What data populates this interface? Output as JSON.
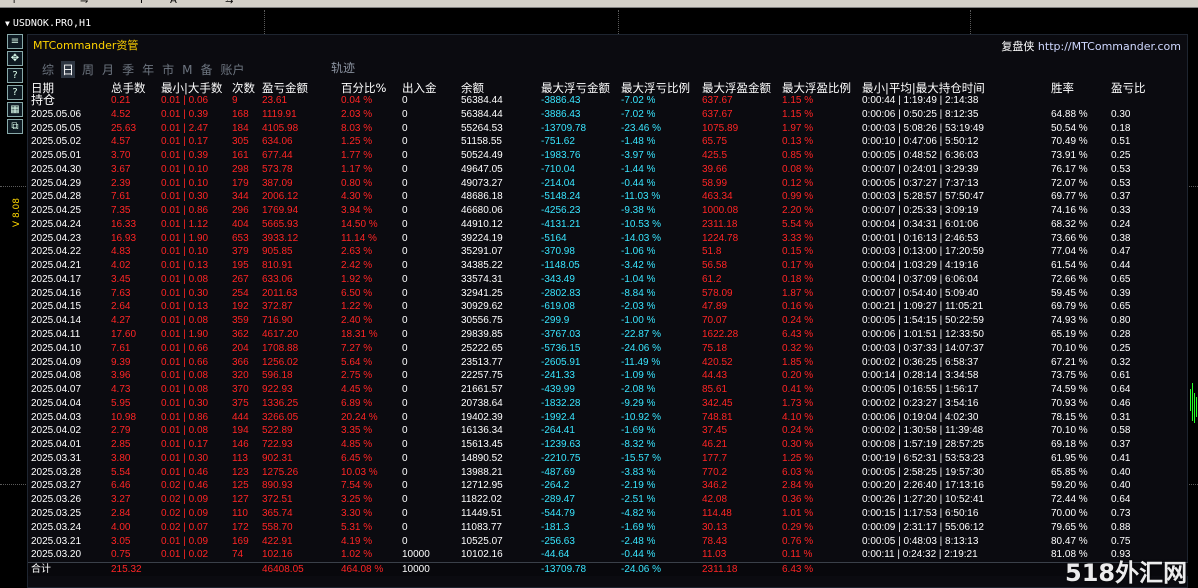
{
  "window": {
    "symbol_title": "USDNOK.PRO,H1",
    "tri": "▼"
  },
  "toolbar": {
    "items": [
      "↑",
      "⇋",
      "F",
      "A",
      "⇆"
    ]
  },
  "side": {
    "label": "V 8.08",
    "icons": [
      "≡",
      "✥",
      "?",
      "?",
      "▦",
      "⧉"
    ]
  },
  "panel": {
    "brand": "MTCommander资管",
    "cred_prefix": "复盘侠",
    "cred_url": "http://MTCommander.com",
    "tabs": [
      "综",
      "日",
      "周",
      "月",
      "季",
      "年",
      "市",
      "M",
      "备",
      "账户"
    ],
    "active_tab": "日",
    "track_label": "轨迹"
  },
  "columns": [
    "日期",
    "总手数",
    "最小|大手数",
    "次数",
    "盈亏金额",
    "百分比%",
    "出入金",
    "余额",
    "最大浮亏金额",
    "最大浮亏比例",
    "最大浮盈金额",
    "最大浮盈比例",
    "最小|平均|最大持仓时间",
    "胜率",
    "盈亏比"
  ],
  "holding": [
    "持仓",
    "0.21",
    "0.01 | 0.06",
    "9",
    "23.61",
    "0.04 %",
    "0",
    "56384.44",
    "-3886.43",
    "-7.02 %",
    "637.67",
    "1.15 %",
    "0:00:44 | 1:19:49 | 2:14:38",
    "",
    ""
  ],
  "rows": [
    [
      "2025.05.06",
      "4.52",
      "0.01 | 0.39",
      "168",
      "1119.91",
      "2.03 %",
      "0",
      "56384.44",
      "-3886.43",
      "-7.02 %",
      "637.67",
      "1.15 %",
      "0:00:06 | 0:50:25 | 8:12:35",
      "64.88 %",
      "0.30"
    ],
    [
      "2025.05.05",
      "25.63",
      "0.01 | 2.47",
      "184",
      "4105.98",
      "8.03 %",
      "0",
      "55264.53",
      "-13709.78",
      "-23.46 %",
      "1075.89",
      "1.97 %",
      "0:00:03 | 5:08:26 | 53:19:49",
      "50.54 %",
      "0.18"
    ],
    [
      "2025.05.02",
      "4.57",
      "0.01 | 0.17",
      "305",
      "634.06",
      "1.25 %",
      "0",
      "51158.55",
      "-751.62",
      "-1.48 %",
      "65.75",
      "0.13 %",
      "0:00:10 | 0:47:06 | 5:50:12",
      "70.49 %",
      "0.51"
    ],
    [
      "2025.05.01",
      "3.70",
      "0.01 | 0.39",
      "161",
      "677.44",
      "1.77 %",
      "0",
      "50524.49",
      "-1983.76",
      "-3.97 %",
      "425.5",
      "0.85 %",
      "0:00:05 | 0:48:52 | 6:36:03",
      "73.91 %",
      "0.25"
    ],
    [
      "2025.04.30",
      "3.67",
      "0.01 | 0.10",
      "298",
      "573.78",
      "1.17 %",
      "0",
      "49647.05",
      "-710.04",
      "-1.44 %",
      "39.66",
      "0.08 %",
      "0:00:07 | 0:24:01 | 3:29:39",
      "76.17 %",
      "0.53"
    ],
    [
      "2025.04.29",
      "2.39",
      "0.01 | 0.10",
      "179",
      "387.09",
      "0.80 %",
      "0",
      "49073.27",
      "-214.04",
      "-0.44 %",
      "58.99",
      "0.12 %",
      "0:00:05 | 0:37:27 | 7:37:13",
      "72.07 %",
      "0.53"
    ],
    [
      "2025.04.28",
      "7.61",
      "0.01 | 0.30",
      "344",
      "2006.12",
      "4.30 %",
      "0",
      "48686.18",
      "-5148.24",
      "-11.03 %",
      "463.34",
      "0.99 %",
      "0:00:03 | 5:28:57 | 57:50:47",
      "69.77 %",
      "0.37"
    ],
    [
      "2025.04.25",
      "7.35",
      "0.01 | 0.86",
      "296",
      "1769.94",
      "3.94 %",
      "0",
      "46680.06",
      "-4256.23",
      "-9.38 %",
      "1000.08",
      "2.20 %",
      "0:00:07 | 0:25:33 | 3:09:19",
      "74.16 %",
      "0.33"
    ],
    [
      "2025.04.24",
      "16.33",
      "0.01 | 1.12",
      "404",
      "5665.93",
      "14.50 %",
      "0",
      "44910.12",
      "-4131.21",
      "-10.53 %",
      "2311.18",
      "5.54 %",
      "0:00:04 | 0:34:31 | 6:01:06",
      "68.32 %",
      "0.24"
    ],
    [
      "2025.04.23",
      "16.93",
      "0.01 | 1.90",
      "653",
      "3933.12",
      "11.14 %",
      "0",
      "39224.19",
      "-5164",
      "-14.03 %",
      "1224.78",
      "3.33 %",
      "0:00:01 | 0:16:13 | 2:46:53",
      "73.66 %",
      "0.38"
    ],
    [
      "2025.04.22",
      "4.83",
      "0.01 | 0.10",
      "379",
      "905.85",
      "2.63 %",
      "0",
      "35291.07",
      "-370.98",
      "-1.06 %",
      "51.8",
      "0.15 %",
      "0:00:03 | 0:13:00 | 17:20:59",
      "77.04 %",
      "0.47"
    ],
    [
      "2025.04.21",
      "4.02",
      "0.01 | 0.13",
      "195",
      "810.91",
      "2.42 %",
      "0",
      "34385.22",
      "-1148.05",
      "-3.42 %",
      "56.58",
      "0.17 %",
      "0:00:04 | 1:03:29 | 4:19:16",
      "61.54 %",
      "0.44"
    ],
    [
      "2025.04.17",
      "3.45",
      "0.01 | 0.08",
      "267",
      "633.06",
      "1.92 %",
      "0",
      "33574.31",
      "-343.49",
      "-1.04 %",
      "61.2",
      "0.18 %",
      "0:00:04 | 0:37:09 | 6:06:04",
      "72.66 %",
      "0.65"
    ],
    [
      "2025.04.16",
      "7.63",
      "0.01 | 0.30",
      "254",
      "2011.63",
      "6.50 %",
      "0",
      "32941.25",
      "-2802.83",
      "-8.84 %",
      "578.09",
      "1.87 %",
      "0:00:07 | 0:54:40 | 5:09:40",
      "59.45 %",
      "0.39"
    ],
    [
      "2025.04.15",
      "2.64",
      "0.01 | 0.13",
      "192",
      "372.87",
      "1.22 %",
      "0",
      "30929.62",
      "-619.08",
      "-2.03 %",
      "47.89",
      "0.16 %",
      "0:00:21 | 1:09:27 | 11:05:21",
      "69.79 %",
      "0.65"
    ],
    [
      "2025.04.14",
      "4.27",
      "0.01 | 0.08",
      "359",
      "716.90",
      "2.40 %",
      "0",
      "30556.75",
      "-299.9",
      "-1.00 %",
      "70.07",
      "0.24 %",
      "0:00:05 | 1:54:15 | 50:22:59",
      "74.93 %",
      "0.80"
    ],
    [
      "2025.04.11",
      "17.60",
      "0.01 | 1.90",
      "362",
      "4617.20",
      "18.31 %",
      "0",
      "29839.85",
      "-3767.03",
      "-22.87 %",
      "1622.28",
      "6.43 %",
      "0:00:06 | 1:01:51 | 12:33:50",
      "65.19 %",
      "0.28"
    ],
    [
      "2025.04.10",
      "7.61",
      "0.01 | 0.66",
      "204",
      "1708.88",
      "7.27 %",
      "0",
      "25222.65",
      "-5736.15",
      "-24.06 %",
      "75.18",
      "0.32 %",
      "0:00:03 | 0:37:33 | 14:07:37",
      "70.10 %",
      "0.25"
    ],
    [
      "2025.04.09",
      "9.39",
      "0.01 | 0.66",
      "366",
      "1256.02",
      "5.64 %",
      "0",
      "23513.77",
      "-2605.91",
      "-11.49 %",
      "420.52",
      "1.85 %",
      "0:00:02 | 0:36:25 | 6:58:37",
      "67.21 %",
      "0.32"
    ],
    [
      "2025.04.08",
      "3.96",
      "0.01 | 0.08",
      "320",
      "596.18",
      "2.75 %",
      "0",
      "22257.75",
      "-241.33",
      "-1.09 %",
      "44.43",
      "0.20 %",
      "0:00:14 | 0:28:14 | 3:34:58",
      "73.75 %",
      "0.61"
    ],
    [
      "2025.04.07",
      "4.73",
      "0.01 | 0.08",
      "370",
      "922.93",
      "4.45 %",
      "0",
      "21661.57",
      "-439.99",
      "-2.08 %",
      "85.61",
      "0.41 %",
      "0:00:05 | 0:16:55 | 1:56:17",
      "74.59 %",
      "0.64"
    ],
    [
      "2025.04.04",
      "5.95",
      "0.01 | 0.30",
      "375",
      "1336.25",
      "6.89 %",
      "0",
      "20738.64",
      "-1832.28",
      "-9.29 %",
      "342.45",
      "1.73 %",
      "0:00:02 | 0:23:27 | 3:54:16",
      "70.93 %",
      "0.46"
    ],
    [
      "2025.04.03",
      "10.98",
      "0.01 | 0.86",
      "444",
      "3266.05",
      "20.24 %",
      "0",
      "19402.39",
      "-1992.4",
      "-10.92 %",
      "748.81",
      "4.10 %",
      "0:00:06 | 0:19:04 | 4:02:30",
      "78.15 %",
      "0.31"
    ],
    [
      "2025.04.02",
      "2.79",
      "0.01 | 0.08",
      "194",
      "522.89",
      "3.35 %",
      "0",
      "16136.34",
      "-264.41",
      "-1.69 %",
      "37.45",
      "0.24 %",
      "0:00:02 | 1:30:58 | 11:39:48",
      "70.10 %",
      "0.58"
    ],
    [
      "2025.04.01",
      "2.85",
      "0.01 | 0.17",
      "146",
      "722.93",
      "4.85 %",
      "0",
      "15613.45",
      "-1239.63",
      "-8.32 %",
      "46.21",
      "0.30 %",
      "0:00:08 | 1:57:19 | 28:57:25",
      "69.18 %",
      "0.37"
    ],
    [
      "2025.03.31",
      "3.80",
      "0.01 | 0.30",
      "113",
      "902.31",
      "6.45 %",
      "0",
      "14890.52",
      "-2210.75",
      "-15.57 %",
      "177.7",
      "1.25 %",
      "0:00:19 | 6:52:31 | 53:53:23",
      "61.95 %",
      "0.41"
    ],
    [
      "2025.03.28",
      "5.54",
      "0.01 | 0.46",
      "123",
      "1275.26",
      "10.03 %",
      "0",
      "13988.21",
      "-487.69",
      "-3.83 %",
      "770.2",
      "6.03 %",
      "0:00:05 | 2:58:25 | 19:57:30",
      "65.85 %",
      "0.40"
    ],
    [
      "2025.03.27",
      "6.46",
      "0.02 | 0.46",
      "125",
      "890.93",
      "7.54 %",
      "0",
      "12712.95",
      "-264.2",
      "-2.19 %",
      "346.2",
      "2.84 %",
      "0:00:20 | 2:26:40 | 17:13:16",
      "59.20 %",
      "0.40"
    ],
    [
      "2025.03.26",
      "3.27",
      "0.02 | 0.09",
      "127",
      "372.51",
      "3.25 %",
      "0",
      "11822.02",
      "-289.47",
      "-2.51 %",
      "42.08",
      "0.36 %",
      "0:00:26 | 1:27:20 | 10:52:41",
      "72.44 %",
      "0.64"
    ],
    [
      "2025.03.25",
      "2.84",
      "0.02 | 0.09",
      "110",
      "365.74",
      "3.30 %",
      "0",
      "11449.51",
      "-544.79",
      "-4.82 %",
      "114.48",
      "1.01 %",
      "0:00:15 | 1:17:53 | 6:50:16",
      "70.00 %",
      "0.73"
    ],
    [
      "2025.03.24",
      "4.00",
      "0.02 | 0.07",
      "172",
      "558.70",
      "5.31 %",
      "0",
      "11083.77",
      "-181.3",
      "-1.69 %",
      "30.13",
      "0.29 %",
      "0:00:09 | 2:31:17 | 55:06:12",
      "79.65 %",
      "0.88"
    ],
    [
      "2025.03.21",
      "3.05",
      "0.01 | 0.09",
      "169",
      "422.91",
      "4.19 %",
      "0",
      "10525.07",
      "-256.63",
      "-2.48 %",
      "78.43",
      "0.76 %",
      "0:00:05 | 0:48:03 | 8:13:13",
      "80.47 %",
      "0.75"
    ],
    [
      "2025.03.20",
      "0.75",
      "0.01 | 0.02",
      "74",
      "102.16",
      "1.02 %",
      "10000",
      "10102.16",
      "-44.64",
      "-0.44 %",
      "11.03",
      "0.11 %",
      "0:00:11 | 0:24:32 | 2:19:21",
      "81.08 %",
      "0.93"
    ]
  ],
  "total": [
    "合计",
    "215.32",
    "",
    "",
    "46408.05",
    "464.08 %",
    "10000",
    "",
    "-13709.78",
    "-24.06 %",
    "2311.18",
    "6.43 %",
    "",
    "",
    ""
  ],
  "watermark": "518外汇网",
  "colors": {
    "loss": "#ff2525",
    "float_loss": "#39e6ff",
    "brand": "#ffd200",
    "background": "#0b0b10"
  }
}
